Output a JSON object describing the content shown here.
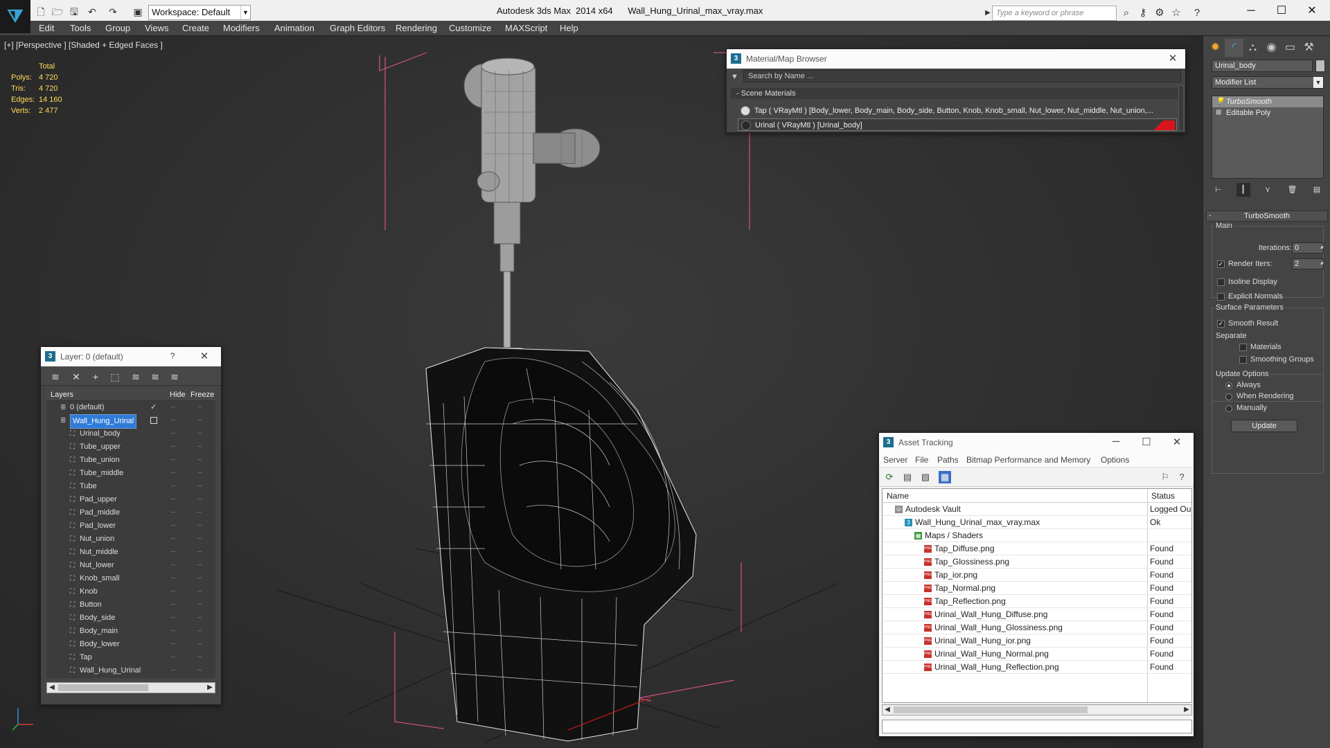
{
  "titlebar": {
    "workspace": "Workspace: Default",
    "app_title": "Autodesk 3ds Max  2014 x64",
    "file_title": "Wall_Hung_Urinal_max_vray.max",
    "search_placeholder": "Type a keyword or phrase"
  },
  "menu": [
    "Edit",
    "Tools",
    "Group",
    "Views",
    "Create",
    "Modifiers",
    "Animation",
    "Graph Editors",
    "Rendering",
    "Customize",
    "MAXScript",
    "Help"
  ],
  "viewport": {
    "label": "[+] [Perspective ] [Shaded + Edged Faces ]",
    "stats": {
      "header": "Total",
      "rows": [
        {
          "k": "Polys:",
          "v": "4 720"
        },
        {
          "k": "Tris:",
          "v": "4 720"
        },
        {
          "k": "Edges:",
          "v": "14 160"
        },
        {
          "k": "Verts:",
          "v": "2 477"
        }
      ]
    }
  },
  "command_panel": {
    "object_name": "Urinal_body",
    "modifier_list": "Modifier List",
    "stack": [
      "TurboSmooth",
      "Editable Poly"
    ],
    "rollout_title": "TurboSmooth",
    "main_label": "Main",
    "iterations_label": "Iterations:",
    "iterations_value": "0",
    "render_iters_label": "Render Iters:",
    "render_iters_value": "2",
    "isoline": "Isoline Display",
    "explicit_normals": "Explicit Normals",
    "surface_params": "Surface Parameters",
    "smooth_result": "Smooth Result",
    "separate": "Separate",
    "materials": "Materials",
    "smoothing_groups": "Smoothing Groups",
    "update_options": "Update Options",
    "always": "Always",
    "when_rendering": "When Rendering",
    "manually": "Manually",
    "update_button": "Update"
  },
  "material_browser": {
    "title": "Material/Map Browser",
    "search_placeholder": "Search by Name ...",
    "section": "- Scene Materials",
    "rows": [
      "Tap  ( VRayMtl ) [Body_lower, Body_main, Body_side, Button, Knob, Knob_small, Nut_lower, Nut_middle, Nut_union,...",
      "Urinal  ( VRayMtl ) [Urinal_body]"
    ]
  },
  "layer_window": {
    "title": "Layer: 0 (default)",
    "help": "?",
    "col_layers": "Layers",
    "col_hide": "Hide",
    "col_freeze": "Freeze",
    "rows": [
      {
        "name": "0 (default)",
        "level": 0,
        "selected": false
      },
      {
        "name": "Wall_Hung_Urinal",
        "level": 0,
        "selected": true
      },
      {
        "name": "Urinal_body",
        "level": 1,
        "selected": false
      },
      {
        "name": "Tube_upper",
        "level": 1,
        "selected": false
      },
      {
        "name": "Tube_union",
        "level": 1,
        "selected": false
      },
      {
        "name": "Tube_middle",
        "level": 1,
        "selected": false
      },
      {
        "name": "Tube",
        "level": 1,
        "selected": false
      },
      {
        "name": "Pad_upper",
        "level": 1,
        "selected": false
      },
      {
        "name": "Pad_middle",
        "level": 1,
        "selected": false
      },
      {
        "name": "Pad_lower",
        "level": 1,
        "selected": false
      },
      {
        "name": "Nut_union",
        "level": 1,
        "selected": false
      },
      {
        "name": "Nut_middle",
        "level": 1,
        "selected": false
      },
      {
        "name": "Nut_lower",
        "level": 1,
        "selected": false
      },
      {
        "name": "Knob_small",
        "level": 1,
        "selected": false
      },
      {
        "name": "Knob",
        "level": 1,
        "selected": false
      },
      {
        "name": "Button",
        "level": 1,
        "selected": false
      },
      {
        "name": "Body_side",
        "level": 1,
        "selected": false
      },
      {
        "name": "Body_main",
        "level": 1,
        "selected": false
      },
      {
        "name": "Body_lower",
        "level": 1,
        "selected": false
      },
      {
        "name": "Tap",
        "level": 1,
        "selected": false
      },
      {
        "name": "Wall_Hung_Urinal",
        "level": 1,
        "selected": false
      }
    ]
  },
  "asset_tracking": {
    "title": "Asset Tracking",
    "menu": [
      "Server",
      "File",
      "Paths",
      "Bitmap Performance and Memory",
      "Options"
    ],
    "col_name": "Name",
    "col_status": "Status",
    "rows": [
      {
        "name": "Autodesk Vault",
        "status": "Logged Ou",
        "level": 0,
        "icon": "vault"
      },
      {
        "name": "Wall_Hung_Urinal_max_vray.max",
        "status": "Ok",
        "level": 1,
        "icon": "max"
      },
      {
        "name": "Maps / Shaders",
        "status": "",
        "level": 2,
        "icon": "maps"
      },
      {
        "name": "Tap_Diffuse.png",
        "status": "Found",
        "level": 3,
        "icon": "png"
      },
      {
        "name": "Tap_Glossiness.png",
        "status": "Found",
        "level": 3,
        "icon": "png"
      },
      {
        "name": "Tap_ior.png",
        "status": "Found",
        "level": 3,
        "icon": "png"
      },
      {
        "name": "Tap_Normal.png",
        "status": "Found",
        "level": 3,
        "icon": "png"
      },
      {
        "name": "Tap_Reflection.png",
        "status": "Found",
        "level": 3,
        "icon": "png"
      },
      {
        "name": "Urinal_Wall_Hung_Diffuse.png",
        "status": "Found",
        "level": 3,
        "icon": "png"
      },
      {
        "name": "Urinal_Wall_Hung_Glossiness.png",
        "status": "Found",
        "level": 3,
        "icon": "png"
      },
      {
        "name": "Urinal_Wall_Hung_ior.png",
        "status": "Found",
        "level": 3,
        "icon": "png"
      },
      {
        "name": "Urinal_Wall_Hung_Normal.png",
        "status": "Found",
        "level": 3,
        "icon": "png"
      },
      {
        "name": "Urinal_Wall_Hung_Reflection.png",
        "status": "Found",
        "level": 3,
        "icon": "png"
      }
    ]
  }
}
